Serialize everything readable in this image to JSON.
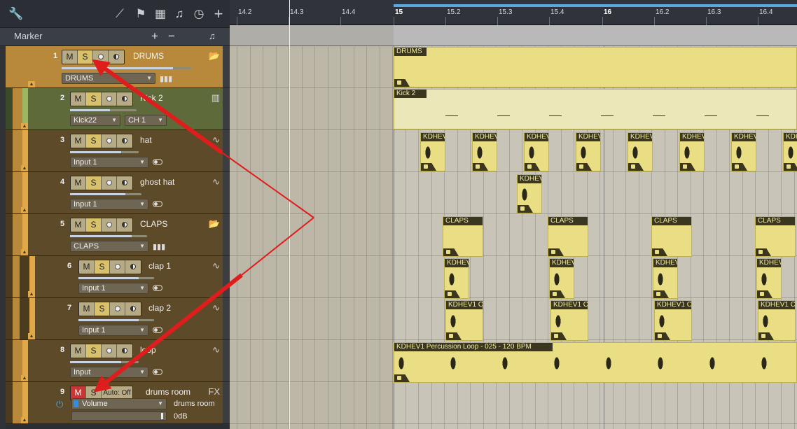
{
  "window": {
    "panel_title": "Marker"
  },
  "toolbar": {
    "icons": [
      "wrench-icon",
      "automation-icon",
      "flag-icon",
      "grid-icon",
      "notes-icon",
      "clock-icon",
      "add-icon"
    ]
  },
  "marker": {
    "label": "Marker",
    "add": "+",
    "remove": "−",
    "note": "♫"
  },
  "ruler": {
    "ticks": [
      "14.2",
      "14.3",
      "14.4",
      "15",
      "15.2",
      "15.3",
      "15.4",
      "16",
      "16.2",
      "16.3",
      "16.4"
    ],
    "major": [
      "15",
      "16"
    ]
  },
  "buttons": {
    "mute": "M",
    "solo": "S",
    "automation": "Auto: Off"
  },
  "tracks": [
    {
      "num": "1",
      "name": "DRUMS",
      "io": "DRUMS",
      "icon": "📂",
      "vol": 0.86,
      "type": "folder"
    },
    {
      "num": "2",
      "name": "Kick 2",
      "io": "Kick22",
      "io2": "CH 1",
      "icon": "▥",
      "vol": 0.6,
      "type": "instrument"
    },
    {
      "num": "3",
      "name": "hat",
      "io": "Input 1",
      "icon": "∿",
      "vol": 0.74,
      "type": "audio"
    },
    {
      "num": "4",
      "name": "ghost hat",
      "io": "Input 1",
      "icon": "∿",
      "vol": 0.77,
      "type": "audio"
    },
    {
      "num": "5",
      "name": "CLAPS",
      "io": "CLAPS",
      "icon": "📂",
      "vol": 0.8,
      "type": "folder"
    },
    {
      "num": "6",
      "name": "clap 1",
      "io": "Input 1",
      "icon": "∿",
      "vol": 0.8,
      "type": "audio"
    },
    {
      "num": "7",
      "name": "clap 2",
      "io": "Input 1",
      "icon": "∿",
      "vol": 0.8,
      "type": "audio"
    },
    {
      "num": "8",
      "name": "loop",
      "io": "Input",
      "icon": "∿",
      "vol": 0.74,
      "type": "audio"
    },
    {
      "num": "9",
      "name": "drums room",
      "io": "Volume",
      "io2": "drums room",
      "value": "0dB",
      "icon": "FX",
      "vol": 0.98,
      "type": "fx"
    }
  ],
  "events": {
    "drums": "DRUMS",
    "kick": "Kick 2",
    "kdhev": "KDHEV",
    "kdhev1": "KDHEV1 C",
    "claps": "CLAPS",
    "loop": "KDHEV1 Percussion Loop - 025 - 120 BPM"
  },
  "colors": {
    "drums": "#b8893a",
    "kick": "#5f6a3a",
    "audio": "#5d4a28",
    "event": "#e9de84",
    "arrow": "#e01d1d",
    "mute_on": "#c93636"
  }
}
